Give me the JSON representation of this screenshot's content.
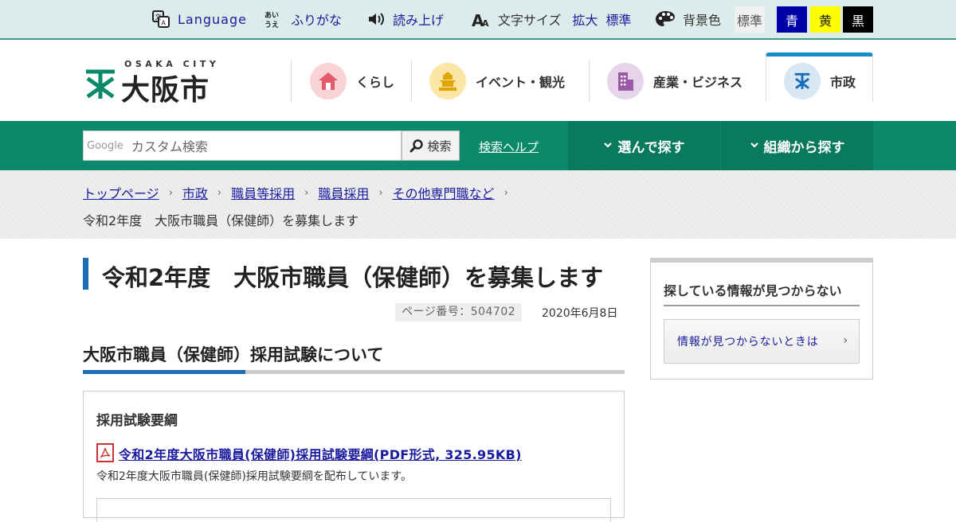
{
  "utility_bar": {
    "language": "Language",
    "furigana": "ふりがな",
    "read_aloud": "読み上げ",
    "text_size_label": "文字サイズ",
    "text_size_enlarge": "拡大",
    "text_size_standard": "標準",
    "background_label": "背景色",
    "bg_standard": "標準",
    "bg_blue": "青",
    "bg_yellow": "黄",
    "bg_black": "黒",
    "colors": {
      "blue": "#0000a8",
      "yellow": "#ffff00",
      "black": "#000000",
      "standard": "#f0f0f0"
    }
  },
  "logo": {
    "sub": "OSAKA CITY",
    "main": "大阪市"
  },
  "nav": {
    "items": [
      {
        "label": "くらし",
        "icon": "house-icon",
        "color": "#f9d3d6"
      },
      {
        "label": "イベント・観光",
        "icon": "castle-icon",
        "color": "#fbe6a6"
      },
      {
        "label": "産業・ビジネス",
        "icon": "building-icon",
        "color": "#e6d5ea"
      },
      {
        "label": "市政",
        "icon": "city-mark-icon",
        "color": "#d7e7f4"
      }
    ]
  },
  "search": {
    "brand": "Google",
    "placeholder": "カスタム検索",
    "button_label": "検索",
    "help_link": "検索ヘルプ",
    "browse_label": "選んで探す",
    "org_label": "組織から探す"
  },
  "breadcrumb": {
    "links": [
      "トップページ",
      "市政",
      "職員等採用",
      "職員採用",
      "その他専門職など"
    ],
    "current": "令和2年度　大阪市職員（保健師）を募集します"
  },
  "main": {
    "title": "令和2年度　大阪市職員（保健師）を募集します",
    "page_number": "ページ番号：504702",
    "date": "2020年6月8日",
    "section_heading": "大阪市職員（保健師）採用試験について",
    "box_heading": "採用試験要綱",
    "pdf_link": "令和2年度大阪市職員(保健師)採用試験要綱(PDF形式, 325.95KB)",
    "pdf_desc": "令和2年度大阪市職員(保健師)採用試験要綱を配布しています。"
  },
  "sidebar": {
    "heading": "探している情報が見つからない",
    "button_label": "情報が見つからないときは"
  }
}
